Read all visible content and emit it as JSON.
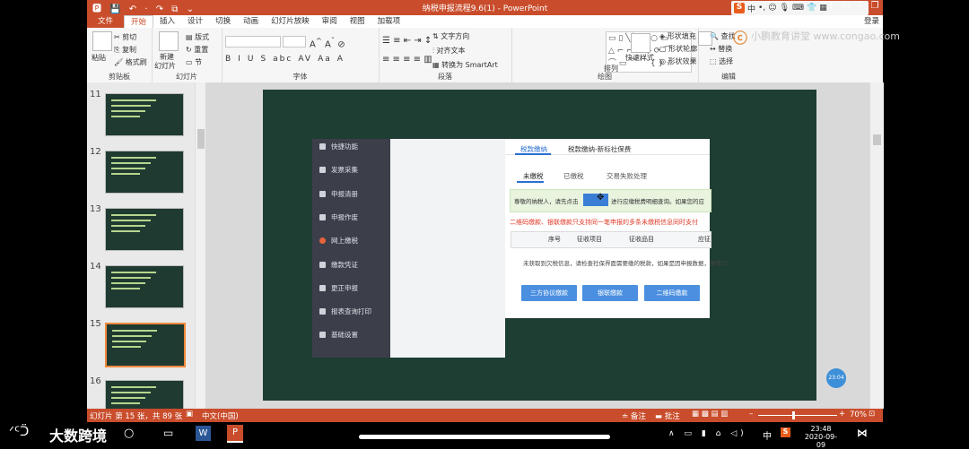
{
  "window": {
    "title": "纳税申报流程9.6(1) - PowerPoint",
    "login": "登录",
    "quick_access": [
      "save-icon",
      "undo-icon",
      "redo-icon",
      "start-icon"
    ]
  },
  "ime": {
    "brand": "S",
    "lang": "中",
    "punct": "•,"
  },
  "menu_tabs": [
    "文件",
    "开始",
    "插入",
    "设计",
    "切换",
    "动画",
    "幻灯片放映",
    "审阅",
    "视图",
    "加载项"
  ],
  "ribbon": {
    "clipboard": {
      "label": "剪贴板",
      "paste": "粘贴",
      "cut": "剪切",
      "copy": "复制",
      "format_painter": "格式刷"
    },
    "slides": {
      "label": "幻灯片",
      "new": "新建",
      "new2": "幻灯片",
      "layout": "版式",
      "reset": "重置",
      "section": "节"
    },
    "font": {
      "label": "字体",
      "buttons": [
        "B",
        "I",
        "U",
        "S",
        "abc",
        "AV",
        "Aa",
        "A"
      ]
    },
    "paragraph": {
      "label": "段落",
      "text_direction": "文字方向",
      "align_text": "对齐文本",
      "smartart": "转换为 SmartArt"
    },
    "drawing": {
      "label": "绘图",
      "arrange": "排列",
      "quick_styles": "快速样式",
      "fill": "形状填充",
      "outline": "形状轮廓",
      "effects": "形状效果"
    },
    "editing": {
      "label": "编辑",
      "find": "查找",
      "replace": "替换",
      "select": "选择"
    },
    "watermark": "小鹏教育讲堂 www.congao.com"
  },
  "thumbnails": [
    {
      "num": "11"
    },
    {
      "num": "12"
    },
    {
      "num": "13"
    },
    {
      "num": "14"
    },
    {
      "num": "15",
      "selected": true
    },
    {
      "num": "16"
    }
  ],
  "slide_content": {
    "nav_items": [
      "快捷功能",
      "发票采集",
      "申报清册",
      "申报作废",
      "网上缴税",
      "缴款凭证",
      "更正申报",
      "报表查询打印",
      "基础设置"
    ],
    "active_nav": "网上缴税",
    "top_tabs": [
      "税款缴纳",
      "税款缴纳-新标社保费"
    ],
    "sub_tabs": [
      "未缴税",
      "已缴税",
      "交易失败处理"
    ],
    "info_text": "尊敬的纳税人，请先点击",
    "info_text2": "进行应缴税费明细查询。如果您的应",
    "warning": "二维码缴款、银联缴款只支持同一笔申报的多条未缴税信息同时支付",
    "table_headers": [
      "序号",
      "征收项目",
      "征收品目",
      "应征"
    ],
    "note": "未获取到欠税信息，请检查社保界面需要缴的税款，如果是因申报数据，推荐20",
    "buttons": [
      "三方协议缴款",
      "银联缴款",
      "二维码缴款"
    ],
    "circle_label": "23:04"
  },
  "statusbar": {
    "slide_info": "幻灯片 第 15 张，共 89 张",
    "lang": "中文(中国)",
    "notes": "备注",
    "comments": "批注",
    "zoom": "70%"
  },
  "taskbar": {
    "time": "23:48",
    "date": "2020-09-09",
    "lang": "中",
    "brand_logo_text": "大数跨境"
  }
}
